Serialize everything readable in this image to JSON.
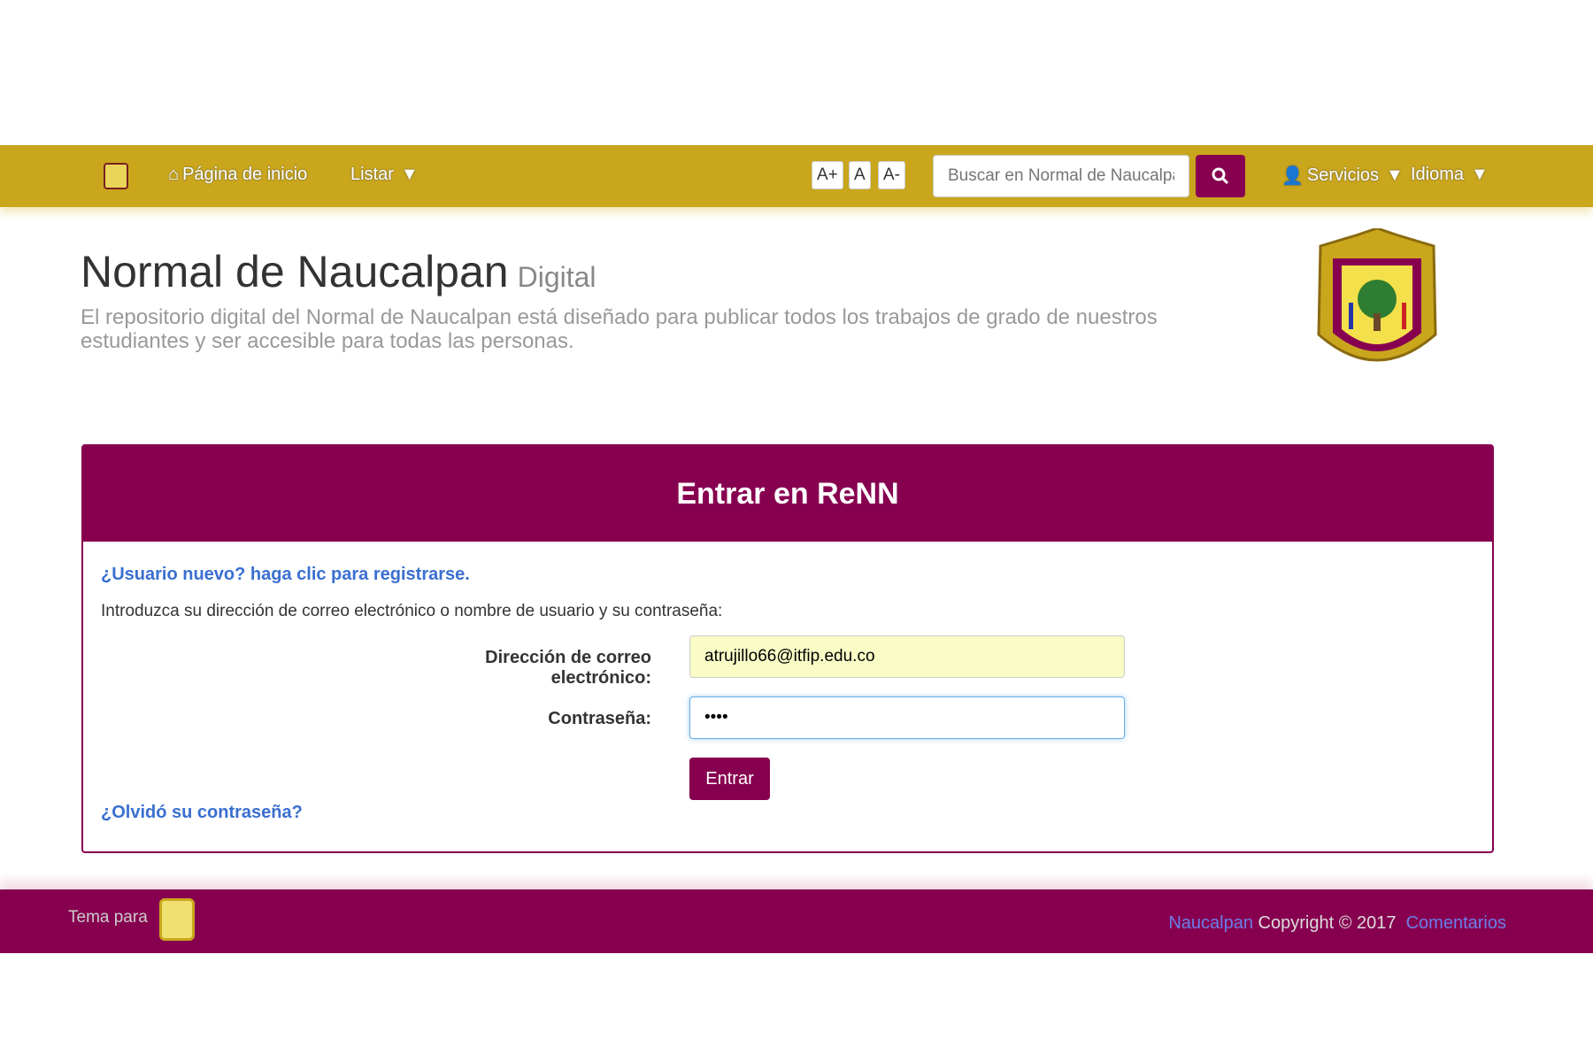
{
  "navbar": {
    "home": "Página de inicio",
    "list": "Listar",
    "font_plus": "A+",
    "font_normal": "A",
    "font_minus": "A-",
    "search_placeholder": "Buscar en Normal de Naucalpan",
    "services": "Servicios",
    "language": "Idioma"
  },
  "header": {
    "title": "Normal de Naucalpan",
    "subtitle": "Digital",
    "description": "El repositorio digital del Normal de Naucalpan está diseñado para publicar todos los trabajos de grado de nuestros estudiantes y ser accesible para todas las personas."
  },
  "login": {
    "heading": "Entrar en ReNN",
    "register_link": "¿Usuario nuevo? haga clic para registrarse.",
    "intro": "Introduzca su dirección de correo electrónico o nombre de usuario y su contraseña:",
    "email_label": "Dirección de correo electrónico:",
    "email_value": "atrujillo66@itfip.edu.co",
    "password_label": "Contraseña:",
    "password_value": "••••",
    "submit": "Entrar",
    "forgot_link": "¿Olvidó su contraseña?"
  },
  "footer": {
    "theme_for": "Tema para",
    "brand_link": "Naucalpan",
    "copyright": "Copyright © 2017",
    "feedback_link": "Comentarios"
  },
  "colors": {
    "navbar": "#c9a61c",
    "primary": "#870050",
    "link": "#3a6fd0"
  }
}
